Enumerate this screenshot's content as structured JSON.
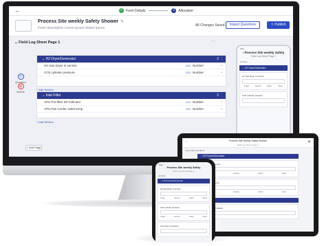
{
  "topbar": {
    "back": "←",
    "step1": "Form Details",
    "step2": "Allocation",
    "check": "✓",
    "step2_num": "2"
  },
  "form": {
    "title": "Process Site weekly Safety Shower",
    "description": "Form description Lorem ipsum dolem ipsum",
    "saved": "All Changes Saved",
    "import_label": "Import Questions",
    "publish_label": "Publish"
  },
  "sheet": {
    "title": "Field Log Sheet Page 1",
    "more": "···",
    "chevron": "⌄"
  },
  "tools": {
    "question": "Question",
    "delete": "Delete"
  },
  "sections": [
    {
      "title": "H2 Dryer/Generator",
      "count": "2",
      "questions": [
        {
          "label": "H2 Gas Dryer in service",
          "type": "Number"
        },
        {
          "label": "CO2 cylinder pressure",
          "type": "Number"
        }
      ]
    },
    {
      "title": "Inlet Filter",
      "count": "2",
      "questions": [
        {
          "label": "APU Pre-filter DP Indicator",
          "type": "Number"
        },
        {
          "label": "APU Fan Cooler outlet temp",
          "type": "Number"
        }
      ]
    }
  ],
  "add_section": "Add Section",
  "add_page": "Add Page",
  "preview": {
    "status_time": "9:41",
    "back": "‹",
    "title": "Process Site weekly Safety",
    "subtitle": "Field Log Sheet Page 1",
    "filter": "All Filter",
    "section": "H2 Dryer/Generator",
    "q1": "H2 Gas Dryer in service",
    "q2": "CO2 cylinder pressure",
    "icons": [
      "Image",
      "Camera",
      "Attach",
      "Notes"
    ]
  },
  "tablet": {
    "back": "←",
    "close": "✕",
    "title": "Process Site weekly Safety Shower",
    "subtitle": "Field Log Sheet Page 1",
    "filter": "Look Field Log Sheet",
    "section1": "H2 Process/Generator",
    "q1": "H2 Gas Dryer in service",
    "q2": "CO2 cylinder pressure",
    "section2": "Inlet Filter",
    "q3": "APU Pre-filter DP Indicator"
  },
  "phone": {
    "status_time": "9:41",
    "title": "Process Site weekly Safety",
    "subtitle": "Field Log Sheet Page 1",
    "filter": "All Filter",
    "section": "H2 Process/Generator",
    "q1": "H2 Gas Dryer in service",
    "q2": "CO2 cylinder pressure",
    "q3": "Gas Dryer in Position",
    "icons": [
      "Image",
      "Camera",
      "Attach",
      "Notes"
    ]
  },
  "colors": {
    "primary": "#2b3a8f",
    "accent": "#2b4cc4",
    "success": "#2fa84f",
    "danger": "#d9342b"
  }
}
